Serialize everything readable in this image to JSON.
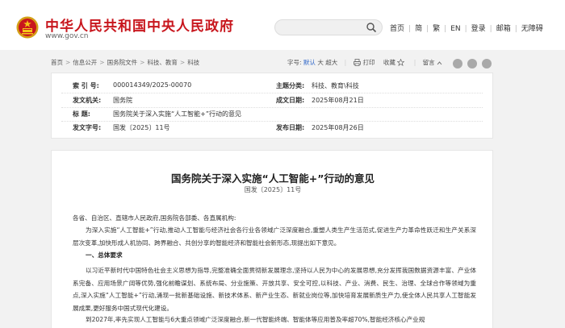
{
  "header": {
    "site_title": "中华人民共和国中央人民政府",
    "site_url": "www.gov.cn",
    "search": {
      "placeholder": ""
    },
    "nav": [
      "首页",
      "简",
      "繁",
      "EN",
      "登录",
      "邮箱",
      "无障碍"
    ]
  },
  "breadcrumb": [
    "首页",
    "信息公开",
    "国务院文件",
    "科技、教育",
    "科技"
  ],
  "tools": {
    "font_label": "字号:",
    "font_default": "默认",
    "font_large": "大",
    "font_xlarge": "超大",
    "print": "打印",
    "favorite": "收藏",
    "message": "留言"
  },
  "colors": {
    "brand_red": "#c8161d",
    "link_blue": "#2a63c7"
  },
  "info": {
    "index_label": "索 引 号:",
    "index_value": "000014349/2025-00070",
    "topic_label": "主题分类:",
    "topic_value": "科技、教育\\科技",
    "issuer_label": "发文机关:",
    "issuer_value": "国务院",
    "created_label": "成文日期:",
    "created_value": "2025年08月21日",
    "title_label": "标 题:",
    "title_value": "国务院关于深入实施“人工智能+”行动的意见",
    "docno_label": "发文字号:",
    "docno_value": "国发〔2025〕11号",
    "published_label": "发布日期:",
    "published_value": "2025年08月26日"
  },
  "article": {
    "title": "国务院关于深入实施“人工智能+”行动的意见",
    "doc_no": "国发〔2025〕11号",
    "recipients": "各省、自治区、直辖市人民政府,国务院各部委、各直属机构:",
    "para1": "为深入实施“人工智能+”行动,推动人工智能与经济社会各行业各领域广泛深度融合,重塑人类生产生活范式,促进生产力革命性跃迁和生产关系深层次变革,加快形成人机协同、跨界融合、共创分享的智能经济和智能社会新形态,现提出如下意见。",
    "section1": "一、总体要求",
    "para2": "以习近平新时代中国特色社会主义思想为指导,完整准确全面贯彻新发展理念,坚持以人民为中心的发展思想,充分发挥我国数据资源丰富、产业体系完备、应用场景广阔等优势,强化前瞻谋划、系统布局、分业施策、开放共享、安全可控,以科技、产业、消费、民生、治理、全球合作等领域为重点,深入实施“人工智能+”行动,涌现一批新基础设施、新技术体系、新产业生态、新就业岗位等,加快培育发展新质生产力,使全体人民共享人工智能发展成果,更好服务中国式现代化建设。",
    "para3": "到2027年,率先实现人工智能与6大重点领域广泛深度融合,新一代智能终端、智能体等应用普及率超70%,智能经济核心产业规"
  }
}
